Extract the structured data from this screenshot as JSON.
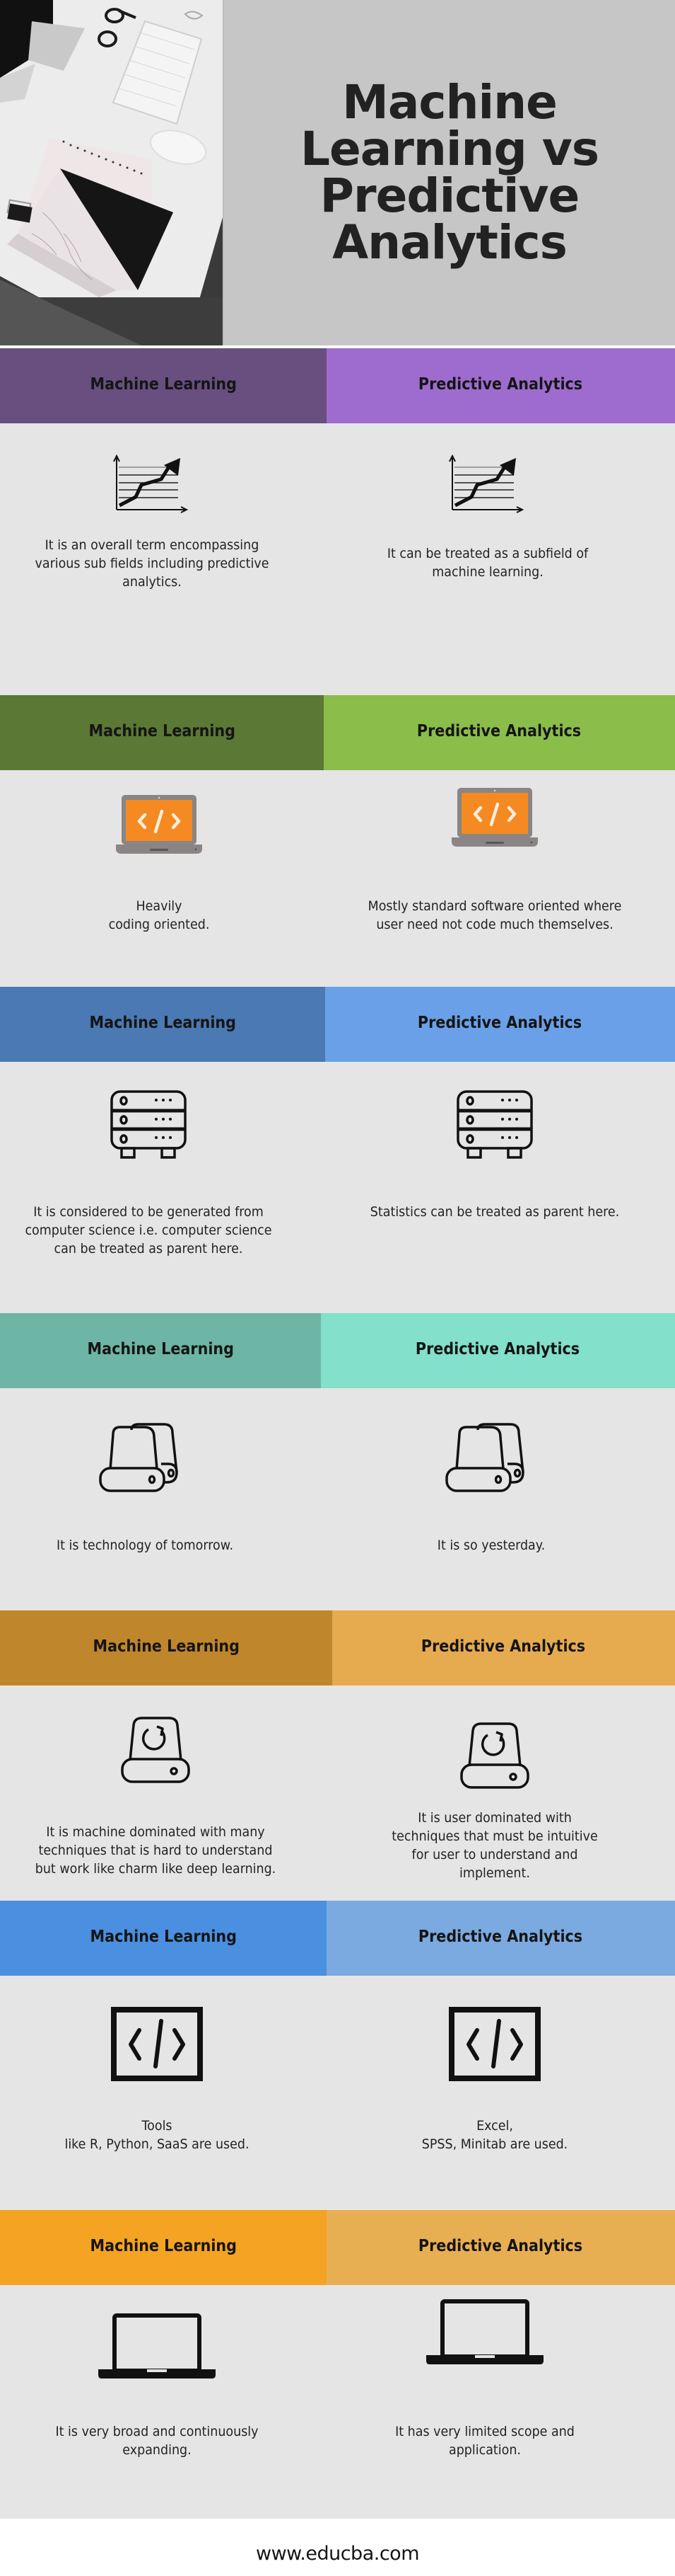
{
  "hero": {
    "title": "Machine\nLearning vs\nPredictive\nAnalytics",
    "photo_icon": "desk-photo-with-keyboard-glasses-notebook"
  },
  "labels": {
    "left": "Machine Learning",
    "right": "Predictive Analytics"
  },
  "sections": [
    {
      "left_color": "#684f80",
      "right_color": "#9e6cce",
      "icon": "trend-chart-icon",
      "left_text": "It is an overall term encompassing\nvarious sub fields including predictive\nanalytics.",
      "right_text": "It can be treated as a subfield of\nmachine learning."
    },
    {
      "left_color": "#5b7834",
      "right_color": "#8bbd4a",
      "icon": "laptop-code-icon",
      "left_text": "Heavily\ncoding oriented.",
      "right_text": "Mostly standard software oriented where\nuser need not code much themselves."
    },
    {
      "left_color": "#4a79b3",
      "right_color": "#69a0e8",
      "icon": "server-rack-icon",
      "left_text": "It is considered to be generated from\ncomputer science i.e. computer science\ncan be treated as parent here.",
      "right_text": "Statistics can be treated as parent here."
    },
    {
      "left_color": "#6db5a5",
      "right_color": "#82e0cb",
      "icon": "hard-drives-icon",
      "left_text": "It is technology of tomorrow.",
      "right_text": "It is so yesterday."
    },
    {
      "left_color": "#c0862b",
      "right_color": "#e6ab4e",
      "icon": "drive-sync-icon",
      "left_text": "It is machine dominated with many\ntechniques that is hard to understand\nbut work like charm like deep learning.",
      "right_text": "It is user dominated with\ntechniques that must be intuitive\nfor user to understand and\nimplement."
    },
    {
      "left_color": "#4a8fe0",
      "right_color": "#7baae1",
      "icon": "code-window-icon",
      "left_text": "Tools\nlike R, Python, SaaS are used.",
      "right_text": "Excel,\nSPSS, Minitab are used."
    },
    {
      "left_color": "#f5a322",
      "right_color": "#e8af52",
      "icon": "laptop-icon",
      "left_text": "It is very broad and continuously\nexpanding.",
      "right_text": "It has very limited scope and\napplication."
    }
  ],
  "footer": {
    "url": "www.educba.com"
  }
}
